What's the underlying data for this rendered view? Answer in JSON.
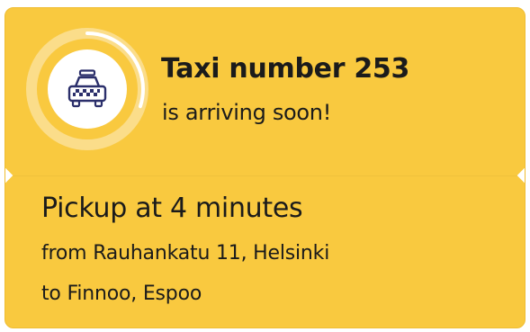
{
  "taxi_card": {
    "background_color": "#F9C93F",
    "icon": "taxi-icon",
    "progress_fraction": 0.3,
    "title": "Taxi number 253",
    "subtitle": "is arriving soon!",
    "pickup": "Pickup at 4 minutes",
    "from": "from Rauhankatu 11, Helsinki",
    "to": "to Finnoo, Espoo"
  }
}
